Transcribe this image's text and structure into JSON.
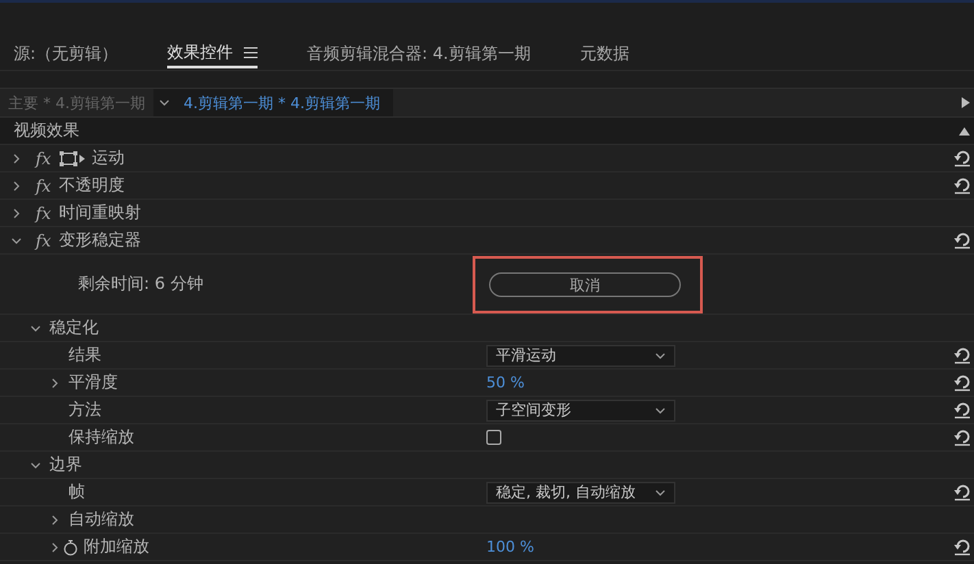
{
  "tabs": [
    {
      "label": "源:（无剪辑）",
      "selected": false,
      "menu": false
    },
    {
      "label": "效果控件",
      "selected": true,
      "menu": true
    },
    {
      "label": "音频剪辑混合器: 4.剪辑第一期",
      "selected": false,
      "menu": false
    },
    {
      "label": "元数据",
      "selected": false,
      "menu": false
    }
  ],
  "clip_bar": {
    "master": "主要 * 4.剪辑第一期",
    "clip": "4.剪辑第一期 * 4.剪辑第一期"
  },
  "section": "视频效果",
  "effects": [
    {
      "kind": "transform_effect",
      "badge": "fx",
      "name": "运动",
      "expanded": false,
      "reset": true
    },
    {
      "kind": "effect",
      "badge": "fx",
      "name": "不透明度",
      "expanded": false,
      "reset": true
    },
    {
      "kind": "effect",
      "badge": "fx",
      "name": "时间重映射",
      "expanded": false,
      "reset": false
    },
    {
      "kind": "effect",
      "badge": "fx",
      "name": "变形稳定器",
      "expanded": true,
      "reset": true,
      "children": [
        {
          "kind": "progress",
          "name": "剩余时间: 6 分钟",
          "button": "取消",
          "highlighted": true
        },
        {
          "kind": "group",
          "name": "稳定化",
          "expanded": true,
          "children": [
            {
              "kind": "dropdown",
              "name": "结果",
              "value": "平滑运动",
              "reset": true
            },
            {
              "kind": "number",
              "name": "平滑度",
              "value": "50 %",
              "expanded": false,
              "reset": true
            },
            {
              "kind": "dropdown",
              "name": "方法",
              "value": "子空间变形",
              "reset": true
            },
            {
              "kind": "checkbox",
              "name": "保持缩放",
              "checked": false,
              "reset": true
            }
          ]
        },
        {
          "kind": "group",
          "name": "边界",
          "expanded": true,
          "children": [
            {
              "kind": "dropdown",
              "name": "帧",
              "value": "稳定, 裁切, 自动缩放",
              "reset": true
            },
            {
              "kind": "label",
              "name": "自动缩放",
              "expanded": false
            },
            {
              "kind": "number",
              "name": "附加缩放",
              "value": "100 %",
              "expanded": false,
              "stopwatch": true,
              "reset": true
            }
          ]
        }
      ]
    }
  ]
}
